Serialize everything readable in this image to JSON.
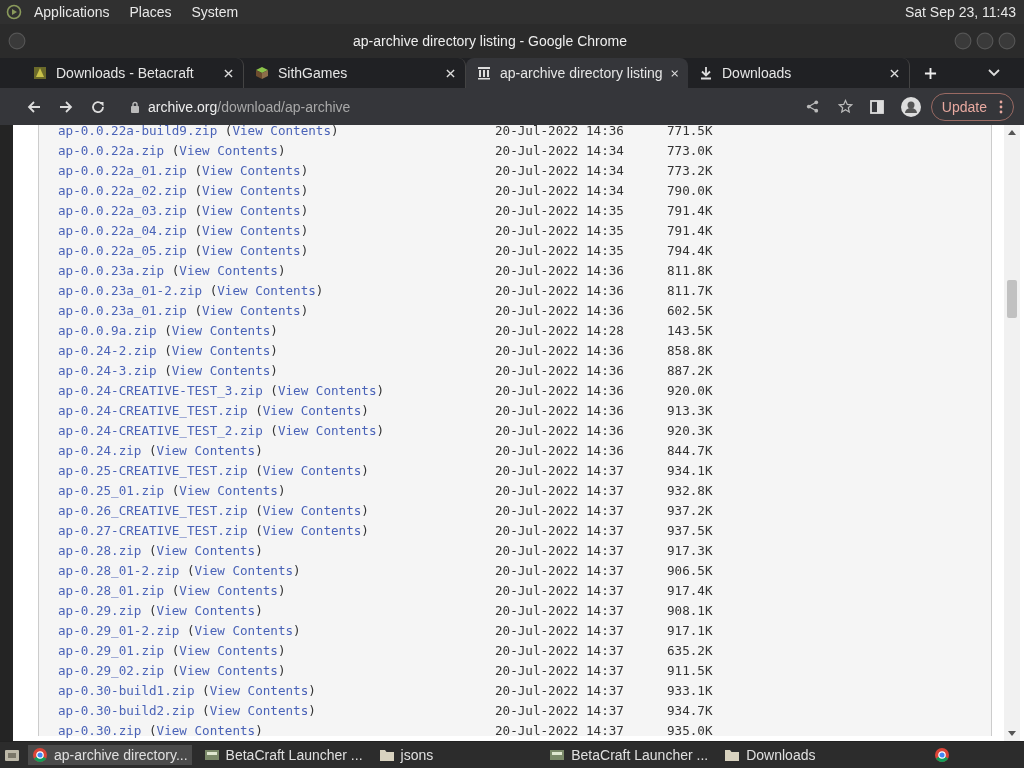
{
  "top_panel": {
    "menus": [
      "Applications",
      "Places",
      "System"
    ],
    "clock": "Sat Sep 23, 11:43"
  },
  "window": {
    "title": "ap-archive directory listing - Google Chrome"
  },
  "tabs": [
    {
      "label": "Downloads - Betacraft",
      "selected": false,
      "kind": "betacraft"
    },
    {
      "label": "SithGames",
      "selected": false,
      "kind": "cube"
    },
    {
      "label": "ap-archive directory listing",
      "selected": true,
      "kind": "archive"
    },
    {
      "label": "Downloads",
      "selected": false,
      "kind": "download"
    }
  ],
  "address_bar": {
    "host": "archive.org",
    "path": "/download/ap-archive"
  },
  "update_button": "Update",
  "rows": [
    {
      "file": "ap-0.0.22a-build9.zip",
      "view": "(View Contents)",
      "date": "20-Jul-2022 14:36",
      "size": "771.5K"
    },
    {
      "file": "ap-0.0.22a.zip",
      "view": "(View Contents)",
      "date": "20-Jul-2022 14:34",
      "size": "773.0K"
    },
    {
      "file": "ap-0.0.22a_01.zip",
      "view": "(View Contents)",
      "date": "20-Jul-2022 14:34",
      "size": "773.2K"
    },
    {
      "file": "ap-0.0.22a_02.zip",
      "view": "(View Contents)",
      "date": "20-Jul-2022 14:34",
      "size": "790.0K"
    },
    {
      "file": "ap-0.0.22a_03.zip",
      "view": "(View Contents)",
      "date": "20-Jul-2022 14:35",
      "size": "791.4K"
    },
    {
      "file": "ap-0.0.22a_04.zip",
      "view": "(View Contents)",
      "date": "20-Jul-2022 14:35",
      "size": "791.4K"
    },
    {
      "file": "ap-0.0.22a_05.zip",
      "view": "(View Contents)",
      "date": "20-Jul-2022 14:35",
      "size": "794.4K"
    },
    {
      "file": "ap-0.0.23a.zip",
      "view": "(View Contents)",
      "date": "20-Jul-2022 14:36",
      "size": "811.8K"
    },
    {
      "file": "ap-0.0.23a_01-2.zip",
      "view": "(View Contents)",
      "date": "20-Jul-2022 14:36",
      "size": "811.7K"
    },
    {
      "file": "ap-0.0.23a_01.zip",
      "view": "(View Contents)",
      "date": "20-Jul-2022 14:36",
      "size": "602.5K"
    },
    {
      "file": "ap-0.0.9a.zip",
      "view": "(View Contents)",
      "date": "20-Jul-2022 14:28",
      "size": "143.5K"
    },
    {
      "file": "ap-0.24-2.zip",
      "view": "(View Contents)",
      "date": "20-Jul-2022 14:36",
      "size": "858.8K"
    },
    {
      "file": "ap-0.24-3.zip",
      "view": "(View Contents)",
      "date": "20-Jul-2022 14:36",
      "size": "887.2K"
    },
    {
      "file": "ap-0.24-CREATIVE-TEST_3.zip",
      "view": "(View Contents)",
      "date": "20-Jul-2022 14:36",
      "size": "920.0K"
    },
    {
      "file": "ap-0.24-CREATIVE_TEST.zip",
      "view": "(View Contents)",
      "date": "20-Jul-2022 14:36",
      "size": "913.3K"
    },
    {
      "file": "ap-0.24-CREATIVE_TEST_2.zip",
      "view": "(View Contents)",
      "date": "20-Jul-2022 14:36",
      "size": "920.3K"
    },
    {
      "file": "ap-0.24.zip",
      "view": "(View Contents)",
      "date": "20-Jul-2022 14:36",
      "size": "844.7K"
    },
    {
      "file": "ap-0.25-CREATIVE_TEST.zip",
      "view": "(View Contents)",
      "date": "20-Jul-2022 14:37",
      "size": "934.1K"
    },
    {
      "file": "ap-0.25_01.zip",
      "view": "(View Contents)",
      "date": "20-Jul-2022 14:37",
      "size": "932.8K"
    },
    {
      "file": "ap-0.26_CREATIVE_TEST.zip",
      "view": "(View Contents)",
      "date": "20-Jul-2022 14:37",
      "size": "937.2K"
    },
    {
      "file": "ap-0.27-CREATIVE_TEST.zip",
      "view": "(View Contents)",
      "date": "20-Jul-2022 14:37",
      "size": "937.5K"
    },
    {
      "file": "ap-0.28.zip",
      "view": "(View Contents)",
      "date": "20-Jul-2022 14:37",
      "size": "917.3K"
    },
    {
      "file": "ap-0.28_01-2.zip",
      "view": "(View Contents)",
      "date": "20-Jul-2022 14:37",
      "size": "906.5K"
    },
    {
      "file": "ap-0.28_01.zip",
      "view": "(View Contents)",
      "date": "20-Jul-2022 14:37",
      "size": "917.4K"
    },
    {
      "file": "ap-0.29.zip",
      "view": "(View Contents)",
      "date": "20-Jul-2022 14:37",
      "size": "908.1K"
    },
    {
      "file": "ap-0.29_01-2.zip",
      "view": "(View Contents)",
      "date": "20-Jul-2022 14:37",
      "size": "917.1K"
    },
    {
      "file": "ap-0.29_01.zip",
      "view": "(View Contents)",
      "date": "20-Jul-2022 14:37",
      "size": "635.2K"
    },
    {
      "file": "ap-0.29_02.zip",
      "view": "(View Contents)",
      "date": "20-Jul-2022 14:37",
      "size": "911.5K"
    },
    {
      "file": "ap-0.30-build1.zip",
      "view": "(View Contents)",
      "date": "20-Jul-2022 14:37",
      "size": "933.1K"
    },
    {
      "file": "ap-0.30-build2.zip",
      "view": "(View Contents)",
      "date": "20-Jul-2022 14:37",
      "size": "934.7K"
    },
    {
      "file": "ap-0.30.zip",
      "view": "(View Contents)",
      "date": "20-Jul-2022 14:37",
      "size": "935.0K"
    }
  ],
  "taskbar": [
    {
      "label": "ap-archive directory...",
      "kind": "chrome",
      "selected": true
    },
    {
      "label": "BetaCraft Launcher ...",
      "kind": "betacraft",
      "selected": false
    },
    {
      "label": "jsons",
      "kind": "folder",
      "selected": false
    },
    {
      "label": "BetaCraft Launcher ...",
      "kind": "betacraft",
      "selected": false
    },
    {
      "label": "Downloads",
      "kind": "folder",
      "selected": false
    }
  ]
}
